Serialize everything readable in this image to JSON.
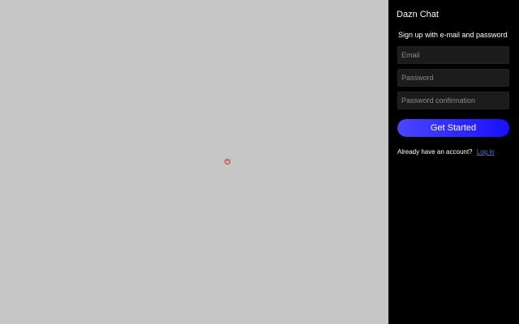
{
  "app": {
    "title": "Dazn Chat"
  },
  "signup": {
    "subtitle": "Sign up with e-mail and password",
    "email": {
      "placeholder": "Email",
      "value": ""
    },
    "password": {
      "placeholder": "Password",
      "value": ""
    },
    "password_confirmation": {
      "placeholder": "Password confirmation",
      "value": ""
    },
    "submit_label": "Get Started",
    "account_prompt": "Already have an account?",
    "login_link": "Log in"
  },
  "colors": {
    "panel_background": "#000000",
    "page_background": "#c6c6c6",
    "button_gradient_start": "#4a46ff",
    "button_gradient_end": "#1a10ff",
    "link": "#5b78d6",
    "spinner": "#c0303a"
  },
  "icons": {
    "loading_indicator": "loading-spinner-icon"
  }
}
